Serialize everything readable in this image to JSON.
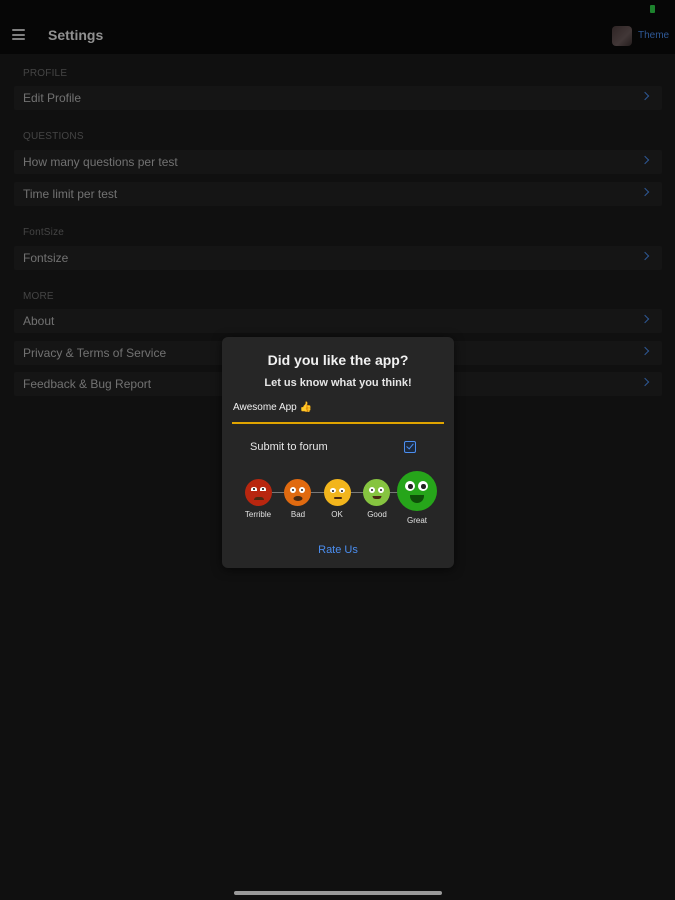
{
  "nav": {
    "title": "Settings",
    "theme_label": "Theme"
  },
  "sections": [
    {
      "header": "PROFILE",
      "items": [
        "Edit Profile"
      ]
    },
    {
      "header": "QUESTIONS",
      "items": [
        "How many questions per test",
        "Time limit per test"
      ]
    },
    {
      "header": "FontSize",
      "items": [
        "Fontsize"
      ]
    },
    {
      "header": "MORE",
      "items": [
        "About",
        "Privacy & Terms of Service",
        "Feedback & Bug Report"
      ]
    }
  ],
  "dialog": {
    "title": "Did you like the app?",
    "subtitle": "Let us know what you think!",
    "input_value": "Awesome App 👍",
    "submit_label": "Submit to forum",
    "submit_checked": true,
    "ratings": [
      {
        "label": "Terrible",
        "color": "#b8260f"
      },
      {
        "label": "Bad",
        "color": "#e06a10"
      },
      {
        "label": "OK",
        "color": "#f2b51c"
      },
      {
        "label": "Good",
        "color": "#86c440"
      },
      {
        "label": "Great",
        "color": "#26a51a"
      }
    ],
    "selected_rating": "Great",
    "rate_button": "Rate Us"
  },
  "colors": {
    "accent": "#4b8ef0",
    "input_underline": "#e0a400"
  }
}
